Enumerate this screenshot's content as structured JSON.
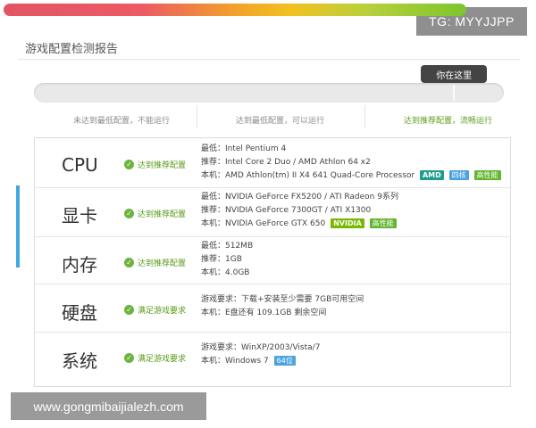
{
  "watermarks": {
    "top": "TG: MYYJJPP",
    "bottom": "www.gongmibaijialezh.com"
  },
  "report": {
    "title": "游戏配置检测报告"
  },
  "meter": {
    "tooltip": "你在这里",
    "labels": [
      "未达到最低配置，不能运行",
      "达到最低配置，可以运行",
      "达到推荐配置，流畅运行"
    ],
    "position_percent": 90,
    "colors": {
      "low": "#e35564",
      "mid": "#f2a12a",
      "high": "#7cc52e"
    }
  },
  "rows": [
    {
      "category": "CPU",
      "status": "达到推荐配置",
      "lines": [
        "最低：Intel Pentium 4",
        "推荐：Intel Core 2 Duo / AMD Athlon 64 x2",
        "本机：AMD Athlon(tm) II X4 641 Quad-Core Processor"
      ],
      "tags": [
        "AMD",
        "四核",
        "高性能"
      ]
    },
    {
      "category": "显卡",
      "status": "达到推荐配置",
      "lines": [
        "最低：NVIDIA GeForce FX5200 / ATI Radeon 9系列",
        "推荐：NVIDIA GeForce 7300GT / ATI X1300",
        "本机：NVIDIA GeForce GTX 650"
      ],
      "tags": [
        "NVIDIA",
        "高性能"
      ]
    },
    {
      "category": "内存",
      "status": "达到推荐配置",
      "lines": [
        "最低：512MB",
        "推荐：1GB",
        "本机：4.0GB"
      ]
    },
    {
      "category": "硬盘",
      "status": "满足游戏要求",
      "lines": [
        "游戏要求：下载+安装至少需要 7GB可用空间",
        "本机：E盘还有 109.1GB 剩余空间"
      ]
    },
    {
      "category": "系统",
      "status": "满足游戏要求",
      "lines": [
        "游戏要求：WinXP/2003/Vista/7",
        "本机：Windows 7"
      ],
      "tags": [
        "64位"
      ]
    }
  ]
}
